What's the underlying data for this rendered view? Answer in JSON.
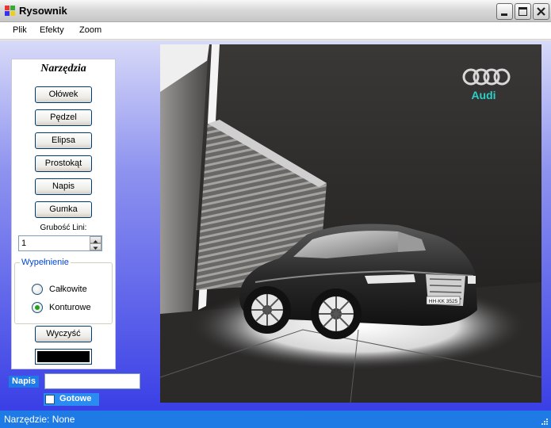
{
  "window": {
    "title": "Rysownik",
    "icon": "paint-app-icon",
    "controls": [
      "minimize-icon",
      "maximize-icon",
      "close-icon"
    ]
  },
  "menu": {
    "items": [
      {
        "label": "Plik"
      },
      {
        "label": "Efekty"
      },
      {
        "label": "Zoom"
      }
    ]
  },
  "tools": {
    "title": "Narzędzia",
    "buttons": [
      {
        "label": "Ołówek"
      },
      {
        "label": "Pędzel"
      },
      {
        "label": "Elipsa"
      },
      {
        "label": "Prostokąt"
      },
      {
        "label": "Napis"
      },
      {
        "label": "Gumka"
      }
    ],
    "thickness_label": "Grubość Lini:",
    "thickness_value": "1",
    "fill_group": {
      "label": "Wypełnienie",
      "options": [
        {
          "label": "Całkowite",
          "selected": false
        },
        {
          "label": "Konturowe",
          "selected": true
        }
      ]
    },
    "clear_label": "Wyczyść",
    "color": "#000000"
  },
  "text_tool": {
    "label": "Napis",
    "input_value": "",
    "ready_label": "Gotowe",
    "ready_checked": false
  },
  "canvas": {
    "logo_text": "Audi",
    "logo_color": "#2ad0c8",
    "plate_text": "HH·KK 3525"
  },
  "status": {
    "text": "Narzędzie: None"
  },
  "colors": {
    "accent_blue": "#1e7be6",
    "panel_gradient_bottom": "#3a3fe6"
  }
}
